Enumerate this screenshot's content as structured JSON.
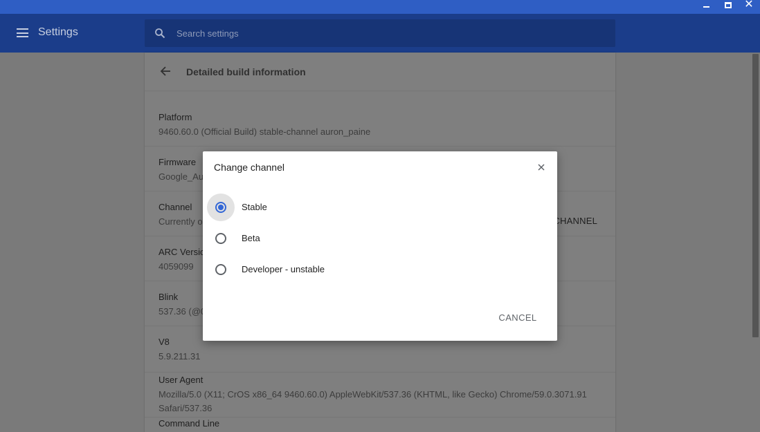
{
  "colors": {
    "titlebar": "#2f5ec4",
    "header": "#1b3d8a",
    "accent": "#3367d6"
  },
  "window_controls": {
    "minimize_icon": "minimize-icon",
    "maximize_icon": "maximize-icon",
    "close_icon": "close-icon"
  },
  "header": {
    "menu_icon": "hamburger-menu-icon",
    "title": "Settings",
    "search": {
      "icon": "search-icon",
      "placeholder": "Search settings"
    }
  },
  "page": {
    "back_icon": "back-arrow-icon",
    "title": "Detailed build information",
    "rows": [
      {
        "label": "Platform",
        "value": "9460.60.0 (Official Build) stable-channel auron_paine"
      },
      {
        "label": "Firmware",
        "value": "Google_Aur"
      },
      {
        "label": "Channel",
        "value": "Currently on",
        "action": "CHANNEL"
      },
      {
        "label": "ARC Versio",
        "value": "4059099"
      },
      {
        "label": "Blink",
        "value": "537.36 (@0"
      },
      {
        "label": "V8",
        "value": "5.9.211.31"
      },
      {
        "label": "User Agent",
        "value": "Mozilla/5.0 (X11; CrOS x86_64 9460.60.0) AppleWebKit/537.36 (KHTML, like Gecko) Chrome/59.0.3071.91",
        "value2": "Safari/537.36"
      },
      {
        "label": "Command Line",
        "value": ""
      }
    ]
  },
  "dialog": {
    "title": "Change channel",
    "close_icon": "close-icon",
    "options": [
      {
        "label": "Stable",
        "checked": true
      },
      {
        "label": "Beta",
        "checked": false
      },
      {
        "label": "Developer - unstable",
        "checked": false
      }
    ],
    "cancel_label": "CANCEL"
  }
}
